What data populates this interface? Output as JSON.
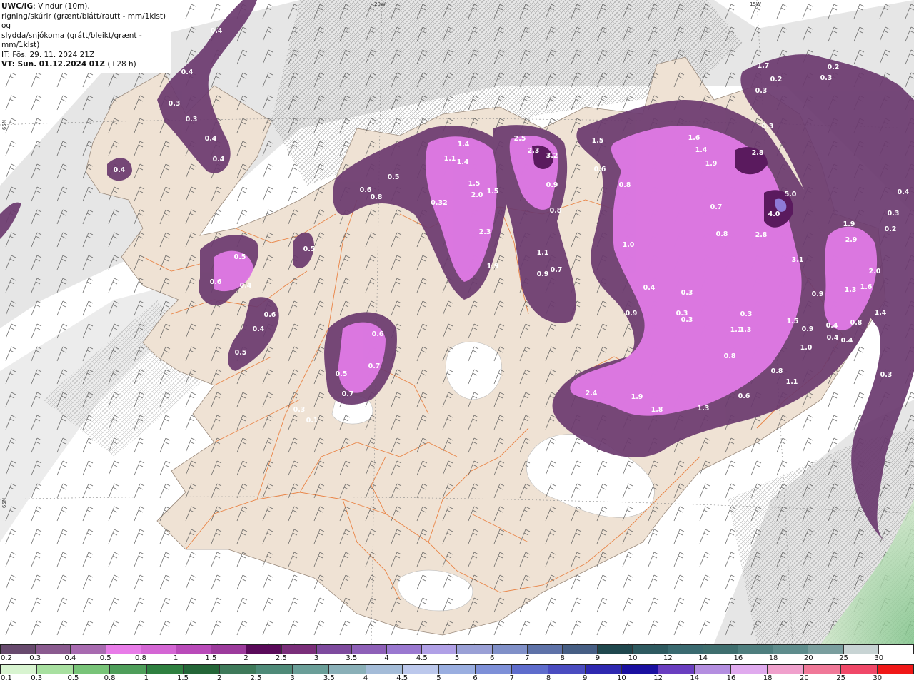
{
  "header": {
    "title_bold": "UWC/IG",
    "title_rest": ": Vindur (10m),",
    "line2": "rigning/skúrir (grænt/blátt/rautt - mm/1klst) og",
    "line3": "slydda/snjókoma (grátt/bleikt/grænt - mm/1klst)",
    "init_time": "IT: Fös. 29. 11. 2024 21Z",
    "valid_time": "VT: Sun. 01.12.2024 01Z",
    "valid_offset": "(+28 h)"
  },
  "graticule_labels": [
    "20W",
    "15W",
    "66N",
    "65N"
  ],
  "precip_labels": [
    "0.4",
    "0.4",
    "0.3",
    "0.3",
    "0.4",
    "0.4",
    "0.4",
    "0.5",
    "0.6",
    "0.8",
    "0.5",
    "0.6",
    "0.4",
    "0.5",
    "0.6",
    "0.4",
    "0.5",
    "0.6",
    "0.7",
    "0.5",
    "0.7",
    "0.3",
    "0.1",
    "1.4",
    "1.1",
    "1.4",
    "1.5",
    "2.0",
    "1.5",
    "0.32",
    "2.3",
    "1.9",
    "2.5",
    "2.3",
    "3.2",
    "0.9",
    "0.8",
    "1.1",
    "0.9",
    "0.7",
    "1.5",
    "0.6",
    "0.8",
    "1.6",
    "1.4",
    "1.9",
    "2.8",
    "1.0",
    "0.7",
    "0.8",
    "5.0",
    "4.0",
    "2.8",
    "3.1",
    "1.9",
    "2.9",
    "2.0",
    "1.6",
    "1.3",
    "1.4",
    "0.8",
    "0.4",
    "0.9",
    "0.3",
    "0.3",
    "0.3",
    "0.4",
    "0.3",
    "1.3",
    "1.1",
    "0.8",
    "1.5",
    "0.9",
    "1.0",
    "0.9",
    "0.4",
    "0.4",
    "0.8",
    "1.1",
    "0.6",
    "2.4",
    "1.9",
    "1.8",
    "1.3",
    "1.7",
    "0.2",
    "0.2",
    "0.3",
    "0.3",
    "0.3",
    "0.3",
    "0.2",
    "0.4",
    "0.3"
  ],
  "legend_snow": {
    "labels": [
      "0.2",
      "0.3",
      "0.4",
      "0.5",
      "0.8",
      "1",
      "1.5",
      "2",
      "2.5",
      "3",
      "3.5",
      "4",
      "4.5",
      "5",
      "6",
      "7",
      "8",
      "9",
      "10",
      "12",
      "14",
      "16",
      "18",
      "20",
      "25",
      "30"
    ],
    "colors": [
      "#684a6e",
      "#8a5a8f",
      "#a86ab0",
      "#e87ce8",
      "#d466d4",
      "#b94ab9",
      "#9c3a9c",
      "#5a0a5a",
      "#7a2e7a",
      "#7e4a9e",
      "#8e60b8",
      "#9a78d0",
      "#b0a0e6",
      "#9aa0d6",
      "#8090c8",
      "#5e72a8",
      "#465e84",
      "#20484e",
      "#2e5a60",
      "#3a6a70",
      "#3e6e6e",
      "#4e7e7e",
      "#5e8c8c",
      "#7a9e9e",
      "#c8d4d4",
      "#ffffff"
    ]
  },
  "legend_rain": {
    "labels": [
      "0.1",
      "0.3",
      "0.5",
      "0.8",
      "1",
      "1.5",
      "2",
      "2.5",
      "3",
      "3.5",
      "4",
      "4.5",
      "5",
      "6",
      "7",
      "8",
      "9",
      "10",
      "12",
      "14",
      "16",
      "18",
      "20",
      "25",
      "30"
    ],
    "colors": [
      "#d8f4d0",
      "#a8e0a0",
      "#78c478",
      "#4e9e5a",
      "#2e8040",
      "#246638",
      "#3e7a5a",
      "#4e8a78",
      "#6a9e98",
      "#8ab0b8",
      "#a4bcd8",
      "#bcc8ec",
      "#9aaee0",
      "#7e90d8",
      "#5e6ccc",
      "#4a4cc0",
      "#2e28b0",
      "#1a10a0",
      "#6a3ec0",
      "#b48ee0",
      "#e0aaee",
      "#f0a0cc",
      "#f07898",
      "#f04868",
      "#f01818"
    ]
  },
  "colors": {
    "land": "#efe2d4",
    "sea_haze": "#e8e8e8",
    "snow_purple": "#e07ae6",
    "snow_dark": "#6b3a6f",
    "road": "#e8742e",
    "glacier": "#ffffff",
    "rain_green": "#8ccc94"
  }
}
